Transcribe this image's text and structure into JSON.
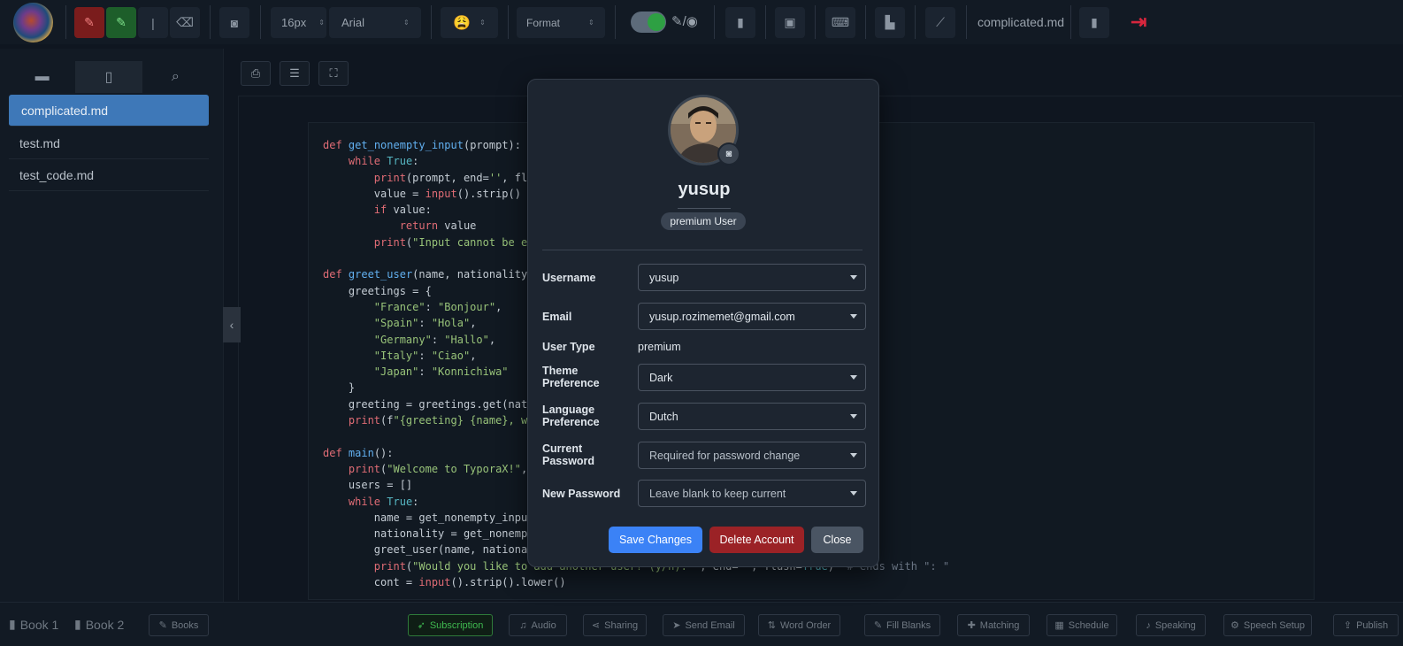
{
  "toolbar": {
    "font_size": "16px",
    "font_family": "Arial",
    "emoji": "😩",
    "format_label": "Format",
    "file_title": "complicated.md",
    "divider_glyph": "|"
  },
  "sidebar": {
    "files": [
      {
        "label": "complicated.md",
        "active": true
      },
      {
        "label": "test.md",
        "active": false
      },
      {
        "label": "test_code.md",
        "active": false
      }
    ]
  },
  "code_lines": [
    "def get_nonempty_input(prompt):",
    "    while True:",
    "        print(prompt, end='', flu",
    "        value = input().strip()",
    "        if value:",
    "            return value",
    "        print(\"Input cannot be em",
    "",
    "def greet_user(name, nationality)",
    "    greetings = {",
    "        \"France\": \"Bonjour\",",
    "        \"Spain\": \"Hola\",",
    "        \"Germany\": \"Hallo\",",
    "        \"Italy\": \"Ciao\",",
    "        \"Japan\": \"Konnichiwa\"",
    "    }",
    "    greeting = greetings.get(nati",
    "    print(f\"{greeting} {name}, wo",
    "",
    "def main():",
    "    print(\"Welcome to TyporaX!\",",
    "    users = []",
    "    while True:",
    "        name = get_nonempty_input",
    "        nationality = get_nonempt",
    "        greet_user(name, national",
    "        print(\"Would you like to add another user? (y/n): \", end='', flush=True)  # ends with \": \"",
    "        cont = input().strip().lower()"
  ],
  "modal": {
    "username": "yusup",
    "badge": "premium User",
    "fields": {
      "username": {
        "label": "Username",
        "value": "yusup"
      },
      "email": {
        "label": "Email",
        "value": "yusup.rozimemet@gmail.com"
      },
      "user_type": {
        "label": "User Type",
        "value": "premium"
      },
      "theme": {
        "label_line1": "Theme",
        "label_line2": "Preference",
        "value": "Dark"
      },
      "language": {
        "label_line1": "Language",
        "label_line2": "Preference",
        "value": "Dutch"
      },
      "current_password": {
        "label_line1": "Current",
        "label_line2": "Password",
        "placeholder": "Required for password change"
      },
      "new_password": {
        "label": "New Password",
        "placeholder": "Leave blank to keep current"
      }
    },
    "buttons": {
      "save": "Save Changes",
      "delete": "Delete Account",
      "close": "Close"
    },
    "colors": {
      "save": "#3b82f6",
      "delete": "#9b2226",
      "close": "#4a5563"
    }
  },
  "bottombar": {
    "books": [
      "Book 1",
      "Book 2"
    ],
    "buttons": [
      "Books",
      "Subscription",
      "Audio",
      "Sharing",
      "Send Email",
      "Word Order",
      "Fill Blanks",
      "Matching",
      "Schedule",
      "Speaking",
      "Speech Setup",
      "Publish"
    ]
  }
}
